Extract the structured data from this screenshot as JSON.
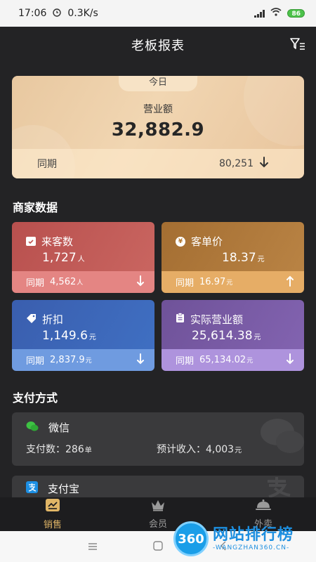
{
  "status_bar": {
    "time": "17:06",
    "speed": "0.3K/s",
    "battery": "86"
  },
  "header": {
    "title": "老板报表"
  },
  "hero": {
    "tab": "今日",
    "label": "营业额",
    "value": "32,882.9",
    "compare_label": "同期",
    "compare_value": "80,251"
  },
  "merchant": {
    "title": "商家数据",
    "cards": [
      {
        "name": "来客数",
        "value": "1,727",
        "unit": "人",
        "compare_label": "同期",
        "compare_value": "4,562",
        "compare_unit": "人",
        "trend": "down",
        "color_top": "#c25a56",
        "color_foot": "#e08684"
      },
      {
        "name": "客单价",
        "value": "18.37",
        "unit": "元",
        "compare_label": "同期",
        "compare_value": "16.97",
        "compare_unit": "元",
        "trend": "up",
        "color_top": "#b47a38",
        "color_foot": "#e6ad6a"
      },
      {
        "name": "折扣",
        "value": "1,149.6",
        "unit": "元",
        "compare_label": "同期",
        "compare_value": "2,837.9",
        "compare_unit": "元",
        "trend": "down",
        "color_top": "#3c66b4",
        "color_foot": "#6e9bde"
      },
      {
        "name": "实际营业额",
        "value": "25,614.38",
        "unit": "元",
        "compare_label": "同期",
        "compare_value": "65,134.02",
        "compare_unit": "元",
        "trend": "down",
        "color_top": "#7a5aa6",
        "color_foot": "#ad92dc"
      }
    ]
  },
  "payment": {
    "title": "支付方式",
    "methods": [
      {
        "name": "微信",
        "count_label": "支付数：",
        "count": "286",
        "count_unit": "单",
        "income_label": "预计收入：",
        "income": "4,003",
        "income_unit": "元"
      },
      {
        "name": "支付宝"
      }
    ]
  },
  "tabbar": {
    "items": [
      {
        "label": "销售",
        "icon": "sales-icon"
      },
      {
        "label": "会员",
        "icon": "crown-icon"
      },
      {
        "label": "外卖",
        "icon": "cloche-icon"
      }
    ]
  },
  "watermark": {
    "brand": "网站排行榜",
    "site": "-WANGZHAN360.CN-",
    "logo": "360"
  }
}
